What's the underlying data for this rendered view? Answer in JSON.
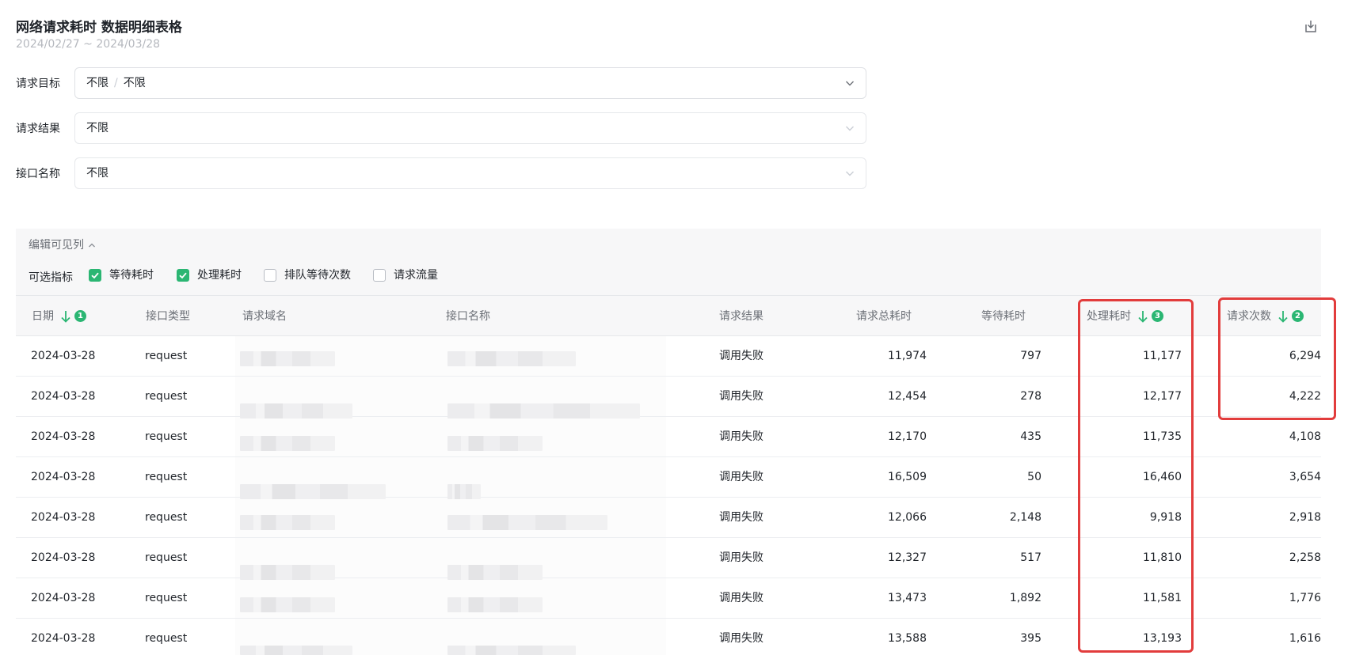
{
  "page": {
    "title": "网络请求耗时 数据明细表格",
    "date_range": "2024/02/27 ~ 2024/03/28"
  },
  "filters": [
    {
      "label": "请求目标",
      "value_parts": [
        "不限",
        "不限"
      ],
      "separator": "/"
    },
    {
      "label": "请求结果",
      "value": "不限"
    },
    {
      "label": "接口名称",
      "value": "不限"
    }
  ],
  "visible_columns": {
    "toggle_label": "编辑可见列",
    "metrics_label": "可选指标",
    "options": [
      {
        "label": "等待耗时",
        "checked": true
      },
      {
        "label": "处理耗时",
        "checked": true
      },
      {
        "label": "排队等待次数",
        "checked": false
      },
      {
        "label": "请求流量",
        "checked": false
      }
    ]
  },
  "table": {
    "columns": [
      {
        "label": "日期",
        "sort": "desc",
        "sort_order": "1"
      },
      {
        "label": "接口类型"
      },
      {
        "label": "请求域名"
      },
      {
        "label": "接口名称"
      },
      {
        "label": "请求结果"
      },
      {
        "label": "请求总耗时"
      },
      {
        "label": "等待耗时"
      },
      {
        "label": "处理耗时",
        "sort": "desc",
        "sort_order": "3"
      },
      {
        "label": "请求次数",
        "sort": "desc",
        "sort_order": "2"
      }
    ],
    "rows": [
      {
        "date": "2024-03-28",
        "type": "request",
        "result": "调用失败",
        "total": "11,974",
        "wait": "797",
        "process": "11,177",
        "count": "6,294"
      },
      {
        "date": "2024-03-28",
        "type": "request",
        "result": "调用失败",
        "total": "12,454",
        "wait": "278",
        "process": "12,177",
        "count": "4,222"
      },
      {
        "date": "2024-03-28",
        "type": "request",
        "result": "调用失败",
        "total": "12,170",
        "wait": "435",
        "process": "11,735",
        "count": "4,108"
      },
      {
        "date": "2024-03-28",
        "type": "request",
        "result": "调用失败",
        "total": "16,509",
        "wait": "50",
        "process": "16,460",
        "count": "3,654"
      },
      {
        "date": "2024-03-28",
        "type": "request",
        "result": "调用失败",
        "total": "12,066",
        "wait": "2,148",
        "process": "9,918",
        "count": "2,918"
      },
      {
        "date": "2024-03-28",
        "type": "request",
        "result": "调用失败",
        "total": "12,327",
        "wait": "517",
        "process": "11,810",
        "count": "2,258"
      },
      {
        "date": "2024-03-28",
        "type": "request",
        "result": "调用失败",
        "total": "13,473",
        "wait": "1,892",
        "process": "11,581",
        "count": "1,776"
      },
      {
        "date": "2024-03-28",
        "type": "request",
        "result": "调用失败",
        "total": "13,588",
        "wait": "395",
        "process": "13,193",
        "count": "1,616"
      }
    ]
  },
  "colors": {
    "accent": "#2bb673",
    "highlight": "#e23c3c"
  },
  "icons": {
    "export": "export-icon",
    "chevron": "chevron-down-icon",
    "collapse": "chevron-up-icon",
    "sort": "arrow-down-icon"
  }
}
